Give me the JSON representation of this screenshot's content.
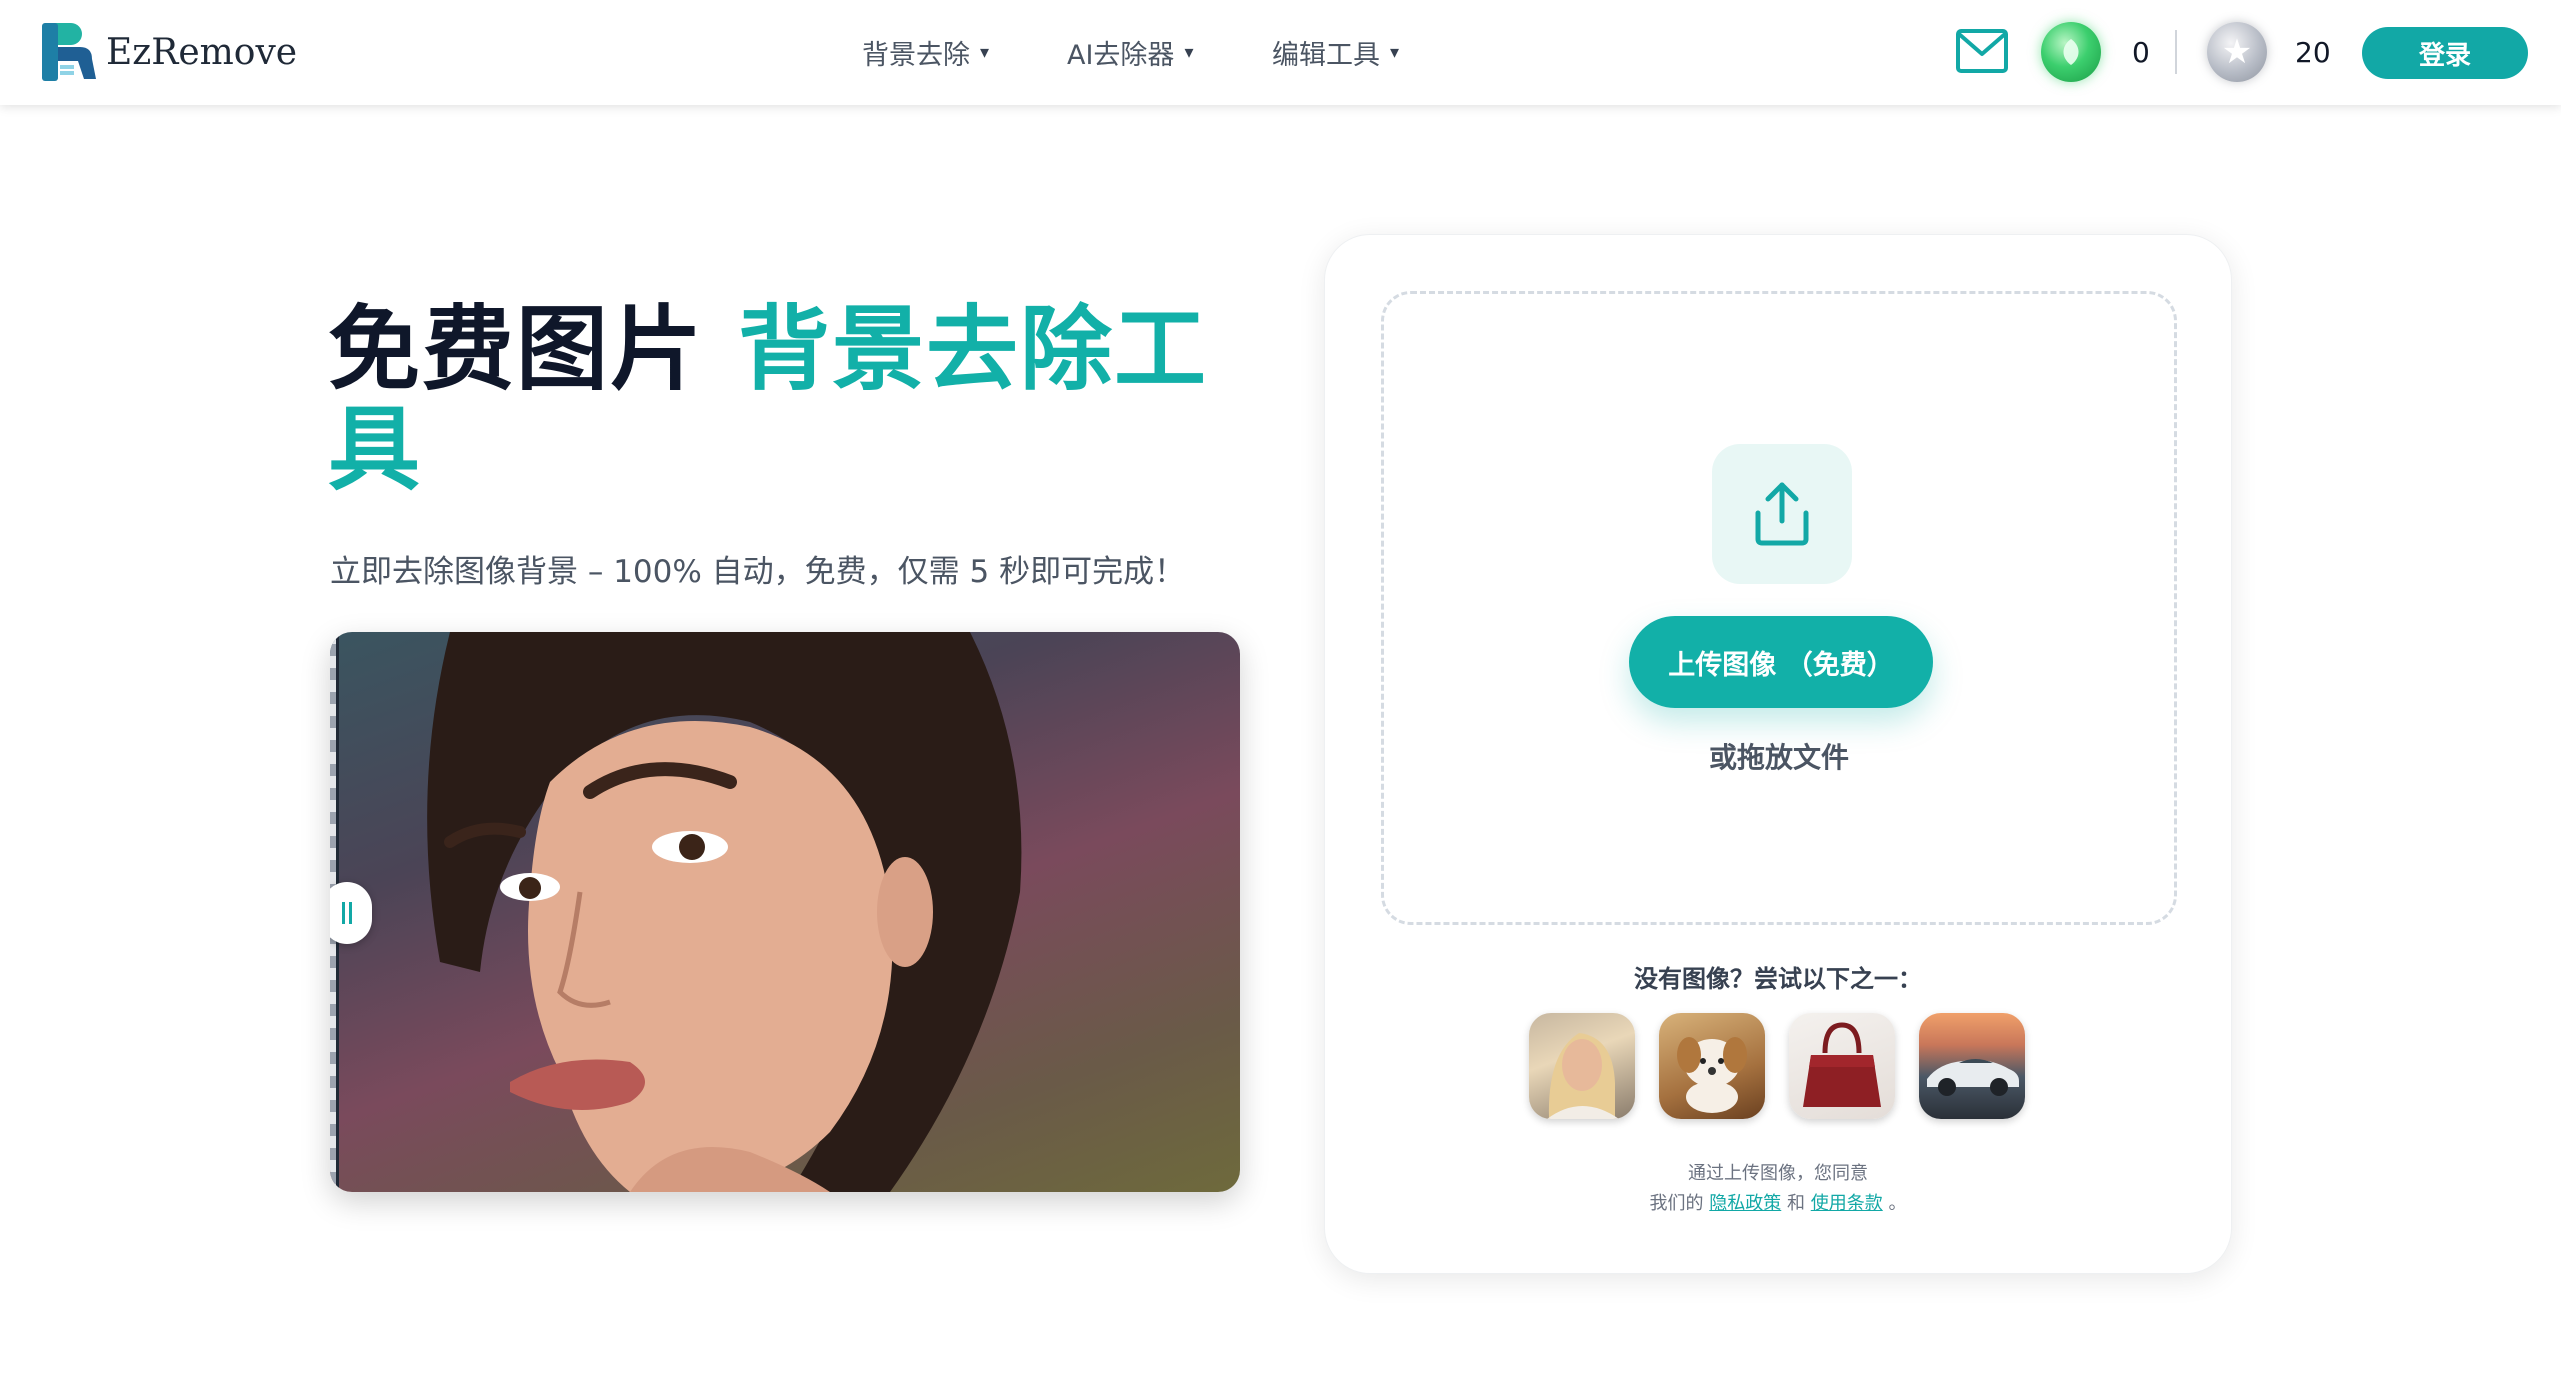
{
  "header": {
    "logo_text": "EzRemove",
    "nav": [
      {
        "label": "背景去除",
        "caret": "▾"
      },
      {
        "label": "AI去除器",
        "caret": "▾"
      },
      {
        "label": "编辑工具",
        "caret": "▾"
      }
    ],
    "gem_count": "0",
    "credit_count": "20",
    "login_label": "登录",
    "icons": {
      "mail": "mail-icon",
      "gem": "green-gem-icon",
      "silver": "silver-star-icon"
    }
  },
  "hero": {
    "title_dark": "免费图片 ",
    "title_accent": "背景去除工具",
    "subtitle": "立即去除图像背景 – 100% 自动，免费，仅需 5 秒即可完成！"
  },
  "upload": {
    "button_label": "上传图像 （免费）",
    "drop_text": "或拖放文件",
    "try_label": "没有图像？尝试以下之一：",
    "samples": [
      "sample-woman",
      "sample-puppy",
      "sample-handbag",
      "sample-car"
    ],
    "terms_line1": "通过上传图像，您同意",
    "terms_prefix": "我们的",
    "privacy_link": "隐私政策",
    "terms_and": "和",
    "terms_link": "使用条款",
    "terms_end": "。"
  },
  "colors": {
    "accent": "#12b0a8",
    "title_dark": "#0f172a",
    "login_bg": "#12a8a6"
  }
}
